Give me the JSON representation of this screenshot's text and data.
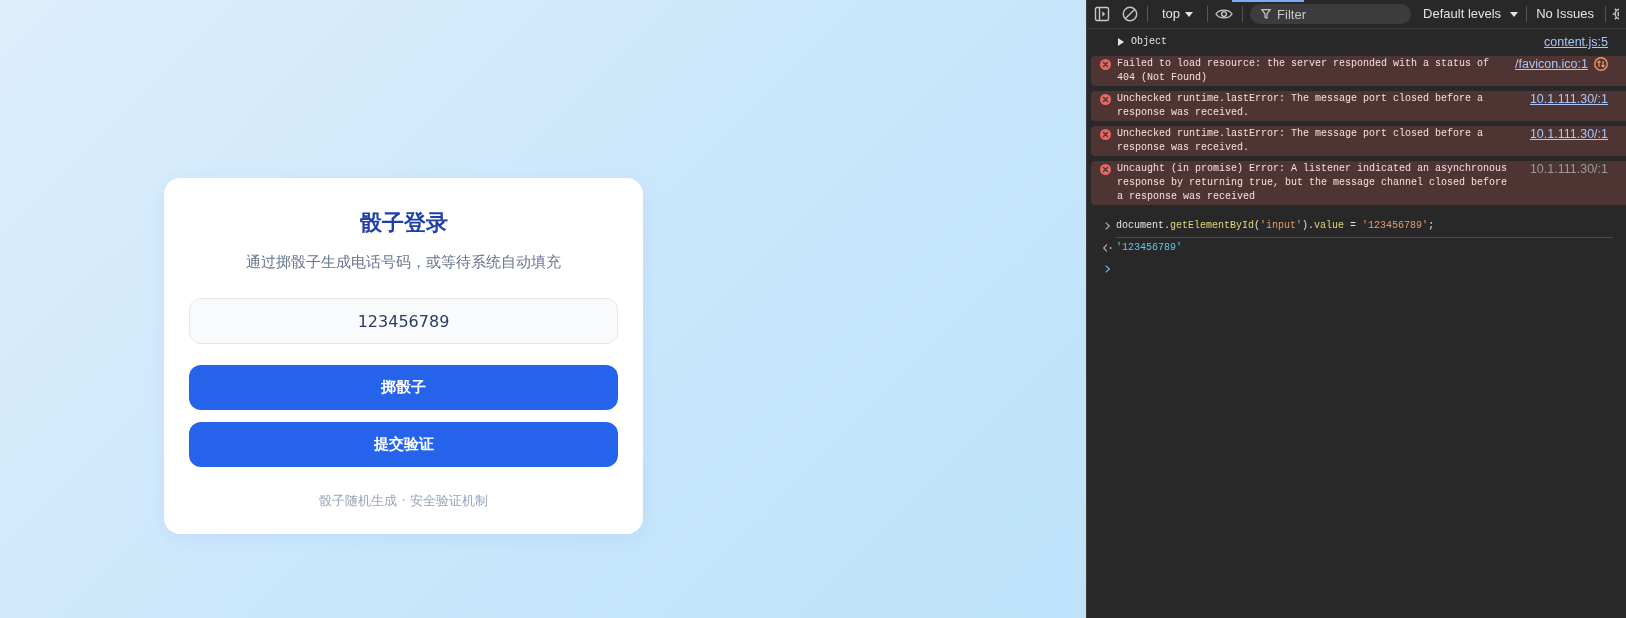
{
  "page": {
    "login_card": {
      "title": "骰子登录",
      "subtitle": "通过掷骰子生成电话号码，或等待系统自动填充",
      "phone_field": {
        "value": "123456789"
      },
      "buttons": [
        "掷骰子",
        "提交验证"
      ],
      "footer": "骰子随机生成 · 安全验证机制"
    }
  },
  "devtools": {
    "toolbar": {
      "context": "top",
      "filter": {
        "placeholder": "Filter"
      },
      "log_levels": "Default levels",
      "issues": "No Issues"
    },
    "console": {
      "messages": [
        {
          "kind": "log",
          "text": "Object",
          "expanded": false,
          "source": "content.js:5",
          "source_linked": true
        },
        {
          "kind": "network_error",
          "text": "Failed to load resource: the server responded with a status of 404 (Not Found)",
          "source": "/favicon.ico:1",
          "source_linked": true
        },
        {
          "kind": "error",
          "text": "Unchecked runtime.lastError: The message port closed before a response was received.",
          "source": "10.1.111.30/:1",
          "source_linked": true
        },
        {
          "kind": "error",
          "text": "Unchecked runtime.lastError: The message port closed before a response was received.",
          "source": "10.1.111.30/:1",
          "source_linked": true
        },
        {
          "kind": "error",
          "text": "Uncaught (in promise) Error: A listener indicated an asynchronous response by returning true, but the message channel closed before a response was received",
          "source": "10.1.111.30/:1",
          "source_linked": false
        }
      ],
      "command": {
        "tokens": [
          {
            "kind": "plain",
            "text": "document."
          },
          {
            "kind": "function",
            "text": "getElementById"
          },
          {
            "kind": "plain",
            "text": "("
          },
          {
            "kind": "string",
            "text": "'input'"
          },
          {
            "kind": "plain",
            "text": ")."
          },
          {
            "kind": "property",
            "text": "value"
          },
          {
            "kind": "plain",
            "text": " = "
          },
          {
            "kind": "string",
            "text": "'123456789'"
          },
          {
            "kind": "plain",
            "text": ";"
          }
        ]
      },
      "result": "'123456789'"
    }
  }
}
